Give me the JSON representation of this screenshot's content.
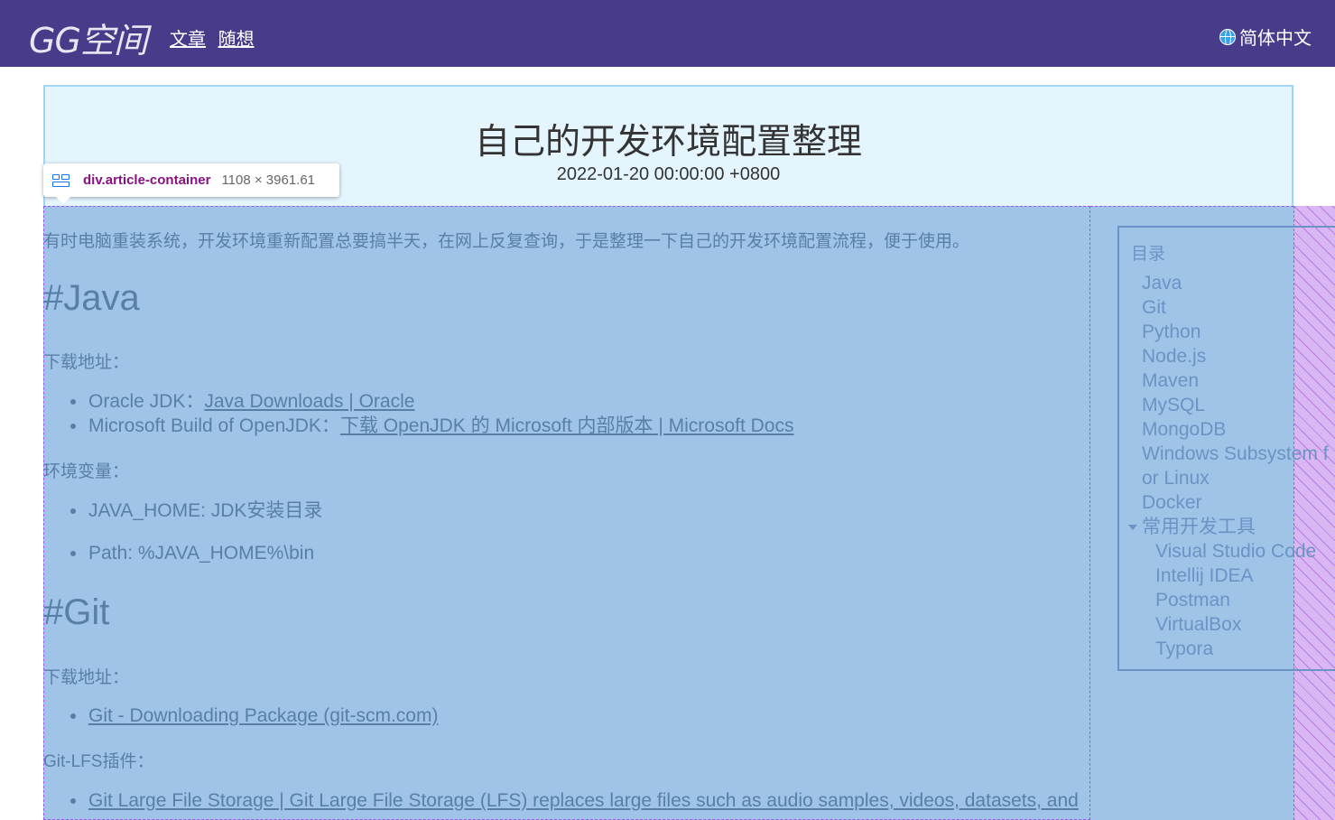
{
  "header": {
    "logo": "GG空间",
    "nav": [
      "文章",
      "随想"
    ],
    "language": "简体中文"
  },
  "article": {
    "title": "自己的开发环境配置整理",
    "date": "2022-01-20 00:00:00 +0800"
  },
  "devtools": {
    "element": "div.article-container",
    "size": "1108 × 3961.61"
  },
  "content": {
    "intro": "有时电脑重装系统，开发环境重新配置总要搞半天，在网上反复查询，于是整理一下自己的开发环境配置流程，便于使用。",
    "java": {
      "heading": "#Java",
      "download_label": "下载地址：",
      "downloads": [
        {
          "prefix": "Oracle JDK：",
          "link": "Java Downloads | Oracle"
        },
        {
          "prefix": "Microsoft Build of OpenJDK：",
          "link": "下载 OpenJDK 的 Microsoft 内部版本 | Microsoft Docs"
        }
      ],
      "env_label": "环境变量：",
      "env": [
        "JAVA_HOME: JDK安装目录",
        "Path: %JAVA_HOME%\\bin"
      ]
    },
    "git": {
      "heading": "#Git",
      "download_label": "下载地址：",
      "download_link": "Git - Downloading Package (git-scm.com)",
      "lfs_label": "Git-LFS插件：",
      "lfs_link": "Git Large File Storage | Git Large File Storage (LFS) replaces large files such as audio samples, videos, datasets, and"
    }
  },
  "toc": {
    "title": "目录",
    "items": [
      "Java",
      "Git",
      "Python",
      "Node.js",
      "Maven",
      "MySQL",
      "MongoDB",
      "Windows Subsystem f",
      "or Linux",
      "Docker"
    ],
    "group": "常用开发工具",
    "sub_items": [
      "Visual Studio Code",
      "Intellij IDEA",
      "Postman",
      "VirtualBox",
      "Typora"
    ]
  }
}
